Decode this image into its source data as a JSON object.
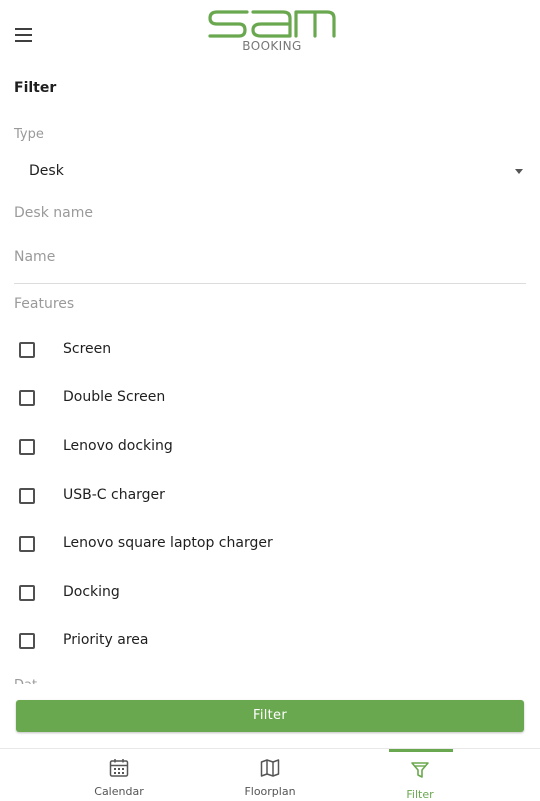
{
  "header": {
    "menu_icon": "hamburger-menu-icon",
    "logo_text": "sam",
    "logo_subtitle": "BOOKING"
  },
  "filter": {
    "title": "Filter",
    "type_label": "Type",
    "type_value": "Desk",
    "desk_name_placeholder": "Desk name",
    "name_placeholder": "Name",
    "features_label": "Features",
    "features": [
      {
        "label": "Screen",
        "checked": false
      },
      {
        "label": "Double Screen",
        "checked": false
      },
      {
        "label": "Lenovo docking",
        "checked": false
      },
      {
        "label": "USB-C charger",
        "checked": false
      },
      {
        "label": "Lenovo square laptop charger",
        "checked": false
      },
      {
        "label": "Docking",
        "checked": false
      },
      {
        "label": "Priority area",
        "checked": false
      }
    ],
    "next_section_label_clipped": "Dat",
    "button_label": "Filter"
  },
  "nav": {
    "items": [
      {
        "label": "Calendar",
        "icon": "calendar-icon",
        "active": false
      },
      {
        "label": "Floorplan",
        "icon": "map-icon",
        "active": false
      },
      {
        "label": "Filter",
        "icon": "filter-icon",
        "active": true
      }
    ]
  },
  "colors": {
    "accent": "#6aa84f",
    "text": "#1f1f1f",
    "muted": "#9a9a9a"
  }
}
